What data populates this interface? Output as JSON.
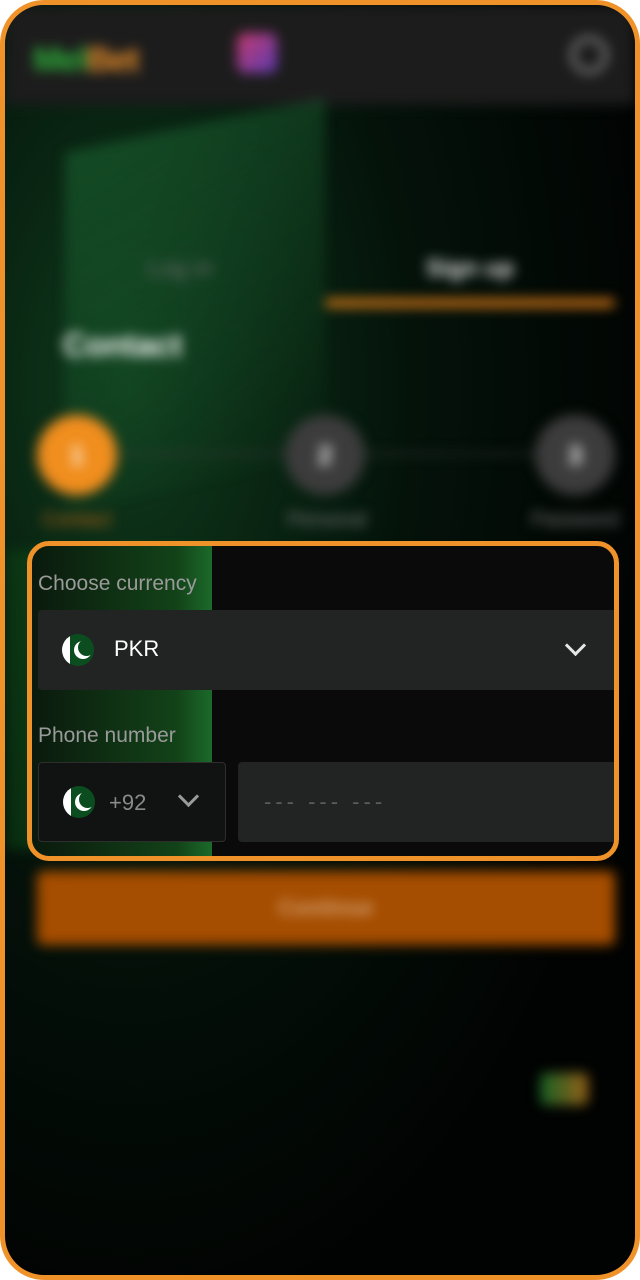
{
  "header": {
    "logo_part1": "Mel",
    "logo_part2": "Bet"
  },
  "tabs": [
    {
      "label": "Log in"
    },
    {
      "label": "Sign up"
    }
  ],
  "section_title": "Contact",
  "steps": [
    {
      "number": "1",
      "label": "Contact"
    },
    {
      "number": "2",
      "label": "Personal"
    },
    {
      "number": "3",
      "label": "Password"
    }
  ],
  "form": {
    "currency_label": "Choose currency",
    "currency_value": "PKR",
    "phone_label": "Phone number",
    "country_code": "+92",
    "phone_placeholder": "--- --- ---"
  },
  "continue_label": "Continue",
  "colors": {
    "accent": "#f0922a",
    "button": "#a54d00",
    "field_bg": "#222323",
    "label": "#9a9a9a"
  },
  "icons": [
    "user-icon",
    "pakistan-flag-icon",
    "chevron-down-icon"
  ]
}
